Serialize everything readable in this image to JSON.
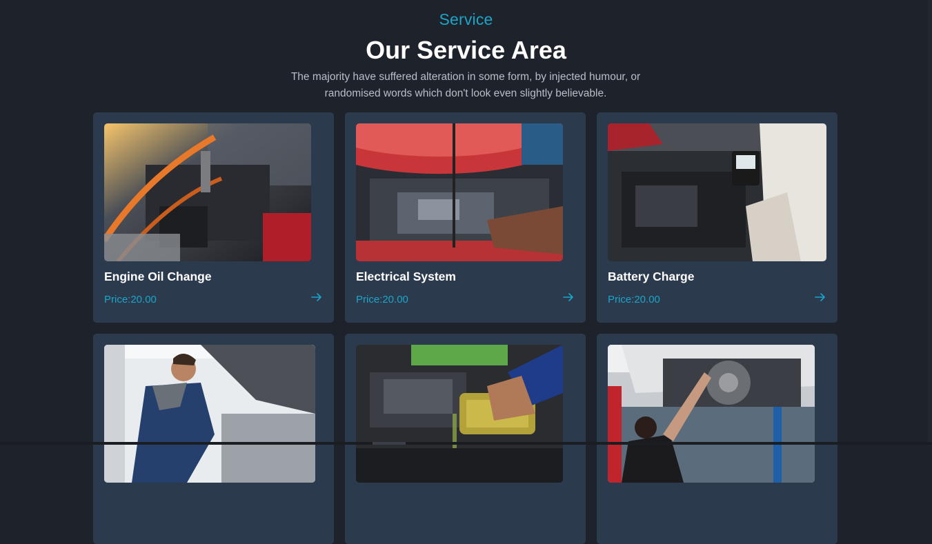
{
  "section": {
    "eyebrow": "Service",
    "title": "Our Service Area",
    "description": "The majority have suffered alteration in some form, by injected humour, or randomised words which don't look even slightly believable."
  },
  "services": [
    {
      "title": "Engine Oil Change",
      "price": "Price:20.00",
      "image": "jumper-cables-engine-photo",
      "arrow_icon": "arrow-right-icon"
    },
    {
      "title": "Electrical System",
      "price": "Price:20.00",
      "image": "mechanic-open-hood-photo",
      "arrow_icon": "arrow-right-icon"
    },
    {
      "title": "Battery Charge",
      "price": "Price:20.00",
      "image": "battery-tester-photo",
      "arrow_icon": "arrow-right-icon"
    },
    {
      "title": "",
      "price": "",
      "image": "mechanic-leaning-engine-photo"
    },
    {
      "title": "",
      "price": "",
      "image": "pouring-engine-oil-photo"
    },
    {
      "title": "",
      "price": "",
      "image": "brake-disc-inspection-photo"
    }
  ],
  "colors": {
    "background": "#1e222a",
    "card": "#2c3a4e",
    "accent": "#1aa6c8"
  }
}
